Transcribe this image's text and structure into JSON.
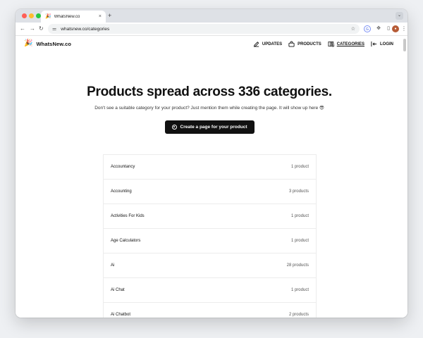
{
  "browser": {
    "tab_title": "WhatsNew.co",
    "tab_favicon": "🎉",
    "tab_close": "×",
    "new_tab": "+",
    "url": "whatsnew.co/categories",
    "back": "←",
    "forward": "→",
    "reload": "↻"
  },
  "site": {
    "logo_icon": "🎉",
    "logo_text": "WhatsNew.co",
    "nav": [
      {
        "label": "UPDATES",
        "icon": "edit-icon"
      },
      {
        "label": "PRODUCTS",
        "icon": "bag-icon"
      },
      {
        "label": "CATEGORIES",
        "icon": "book-icon"
      },
      {
        "label": "LOGIN",
        "icon": "login-icon"
      }
    ]
  },
  "hero": {
    "title": "Products spread across 336 categories.",
    "subtitle": "Don't see a suitable category for your product? Just mention them while creating the page. It will show up here 😎",
    "cta_label": "Create a page for your product"
  },
  "categories": [
    {
      "name": "Accountancy",
      "count": "1 product"
    },
    {
      "name": "Accounting",
      "count": "3 products"
    },
    {
      "name": "Activities For Kids",
      "count": "1 product"
    },
    {
      "name": "Age Calculators",
      "count": "1 product"
    },
    {
      "name": "Ai",
      "count": "28 products"
    },
    {
      "name": "Ai Chat",
      "count": "1 product"
    },
    {
      "name": "Ai Chatbot",
      "count": "2 products"
    }
  ]
}
